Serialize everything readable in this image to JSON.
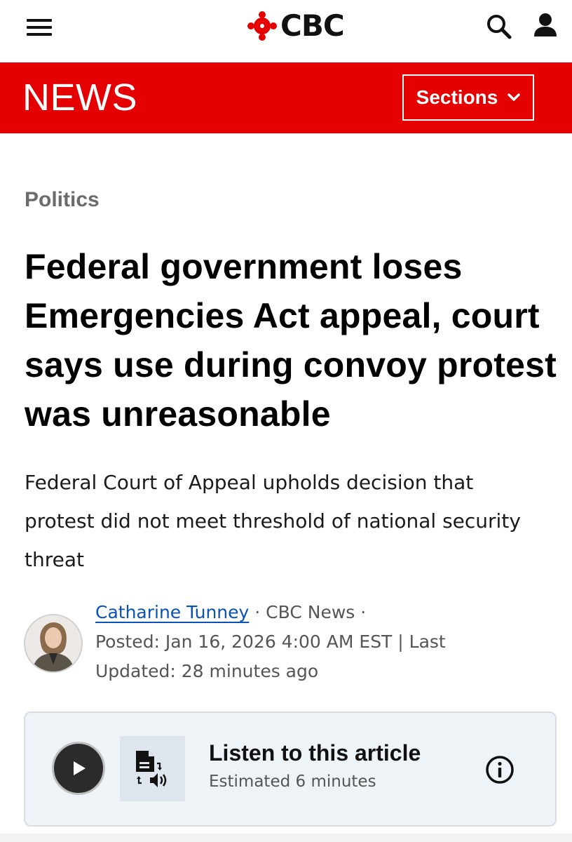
{
  "header": {
    "brand": "CBC",
    "menu_icon": "hamburger-menu-icon",
    "search_icon": "search-icon",
    "account_icon": "user-account-icon",
    "brand_color": "#e40000"
  },
  "news_bar": {
    "title": "NEWS",
    "sections_label": "Sections",
    "sections_icon": "chevron-down-icon"
  },
  "article": {
    "category": "Politics",
    "headline": "Federal government loses Emergencies Act appeal, court says use during convoy protest was unreasonable",
    "deck": "Federal Court of Appeal upholds decision that protest did not meet threshold of national security threat",
    "author": "Catharine Tunney",
    "separator": " · ",
    "outlet": "CBC News",
    "posted": "Posted: Jan 16, 2026 4:00 AM EST | Last Updated: 28 minutes ago"
  },
  "listen": {
    "title": "Listen to this article",
    "estimate": "Estimated 6 minutes",
    "play_icon": "play-icon",
    "tts_icon": "text-to-speech-icon",
    "info_icon": "info-icon"
  }
}
